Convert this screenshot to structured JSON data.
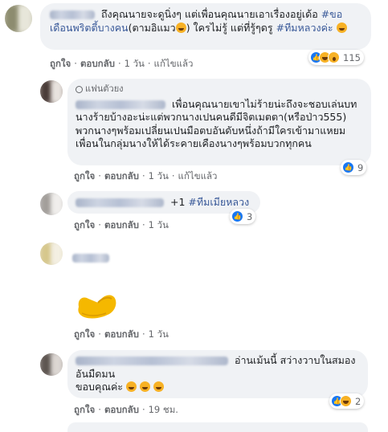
{
  "comments": [
    {
      "text_part1": "ถึงคุณนายจะดูนิ่งๆ แต่เพื่อนคุณนายเอาเรื่องอยู่เด้อ",
      "hashtag1": "#ขอเดือนพริตตี้บางคน",
      "text_part2": "(ตามอิแมว",
      "text_part3": ") ใครไม่รู้ แต่ที่รู้ๆดรู",
      "hashtag2": "#ทีมหลวงค่ะ",
      "actions": {
        "like": "ถูกใจ",
        "reply": "ตอบกลับ",
        "time": "1 วัน",
        "edited": "แก้ไขแล้ว"
      },
      "reactions": {
        "icons": [
          "like-icon",
          "haha-icon",
          "wow-icon"
        ],
        "count": "115"
      }
    },
    {
      "badge": "แฟนตัวยง",
      "text": "เพื่อนคุณนายเขาไม่ร้ายน่ะถึงจะชอบเล่นบทนางร้ายบ้างอะน่ะแต่พวกนางเปนคนดีมีจิตเมตตา(หรือป่าว555) พวกนางๆพร้อมเปลี่ยนเปนมือตบอันดับหนึ่งถ้ามีใครเข้ามาแหยมเพื่อนในกลุ่มนางให้ได้ระคายเคืองนางๆพร้อมบวกทุกคน",
      "actions": {
        "like": "ถูกใจ",
        "reply": "ตอบกลับ",
        "time": "1 วัน",
        "edited": "แก้ไขแล้ว"
      },
      "reactions": {
        "icons": [
          "like-icon"
        ],
        "count": "9"
      }
    },
    {
      "text": "+1",
      "hashtag": "#ทีมเมียหลวง",
      "actions": {
        "like": "ถูกใจ",
        "reply": "ตอบกลับ",
        "time": "1 วัน"
      },
      "reactions": {
        "icons": [
          "like-icon"
        ],
        "count": "3"
      }
    },
    {
      "sticker": "flexed-arm-sticker",
      "actions": {
        "like": "ถูกใจ",
        "reply": "ตอบกลับ",
        "time": "1 วัน"
      }
    },
    {
      "text_line1": "อ่านเม้นนี้ สว่างวาบในสมอง",
      "text_line2": "อันมืดมน",
      "text_line3": "ขอบคุณค่ะ",
      "actions": {
        "like": "ถูกใจ",
        "reply": "ตอบกลับ",
        "time": "19 ชม."
      },
      "reactions": {
        "icons": [
          "like-icon",
          "haha-icon"
        ],
        "count": "2"
      }
    }
  ],
  "colors": {
    "link": "#385898",
    "bubble": "#f0f2f5",
    "meta": "#65676b",
    "like_blue": "#1877f2"
  }
}
